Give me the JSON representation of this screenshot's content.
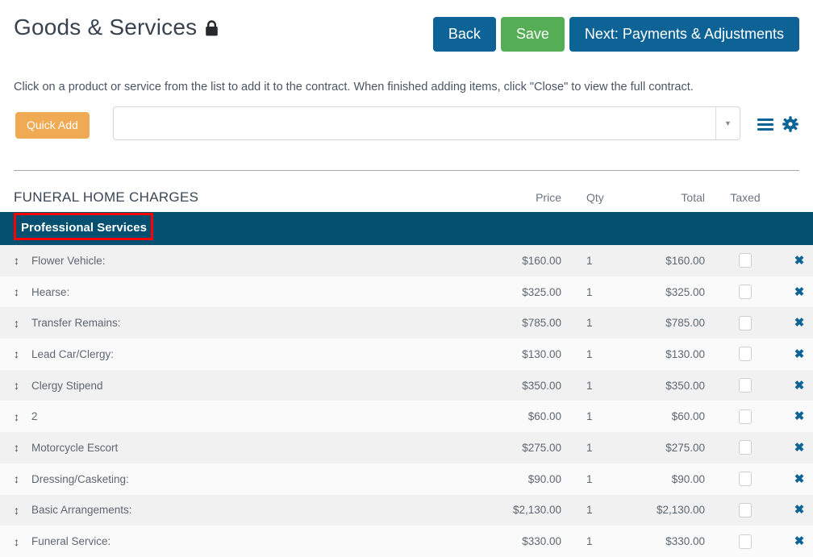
{
  "header": {
    "title": "Goods & Services",
    "lock_icon": "lock-icon",
    "buttons": {
      "back": "Back",
      "save": "Save",
      "next": "Next: Payments & Adjustments"
    }
  },
  "instructions": "Click on a product or service from the list to add it to the contract. When finished adding items, click \"Close\" to view the full contract.",
  "toolbar": {
    "quick_add_label": "Quick Add",
    "search_value": "",
    "search_placeholder": "",
    "caret_icon": "chevron-down-icon",
    "list_icon": "list-icon",
    "gear_icon": "gear-icon"
  },
  "table": {
    "group_title": "FUNERAL HOME CHARGES",
    "columns": {
      "price": "Price",
      "qty": "Qty",
      "total": "Total",
      "taxed": "Taxed"
    },
    "section": {
      "label": "Professional Services",
      "highlighted": true
    },
    "rows": [
      {
        "name": "Flower Vehicle:",
        "price": "$160.00",
        "qty": "1",
        "total": "$160.00",
        "taxed": false,
        "delete_icon": "close-icon"
      },
      {
        "name": "Hearse:",
        "price": "$325.00",
        "qty": "1",
        "total": "$325.00",
        "taxed": false,
        "delete_icon": "close-icon"
      },
      {
        "name": "Transfer Remains:",
        "price": "$785.00",
        "qty": "1",
        "total": "$785.00",
        "taxed": false,
        "delete_icon": "close-icon"
      },
      {
        "name": "Lead Car/Clergy:",
        "price": "$130.00",
        "qty": "1",
        "total": "$130.00",
        "taxed": false,
        "delete_icon": "close-icon"
      },
      {
        "name": "Clergy Stipend",
        "price": "$350.00",
        "qty": "1",
        "total": "$350.00",
        "taxed": false,
        "delete_icon": "close-icon"
      },
      {
        "name": "2",
        "price": "$60.00",
        "qty": "1",
        "total": "$60.00",
        "taxed": false,
        "delete_icon": "close-icon"
      },
      {
        "name": "Motorcycle Escort",
        "price": "$275.00",
        "qty": "1",
        "total": "$275.00",
        "taxed": false,
        "delete_icon": "close-icon"
      },
      {
        "name": "Dressing/Casketing:",
        "price": "$90.00",
        "qty": "1",
        "total": "$90.00",
        "taxed": false,
        "delete_icon": "close-icon"
      },
      {
        "name": "Basic Arrangements:",
        "price": "$2,130.00",
        "qty": "1",
        "total": "$2,130.00",
        "taxed": false,
        "delete_icon": "close-icon"
      },
      {
        "name": "Funeral Service:",
        "price": "$330.00",
        "qty": "1",
        "total": "$330.00",
        "taxed": false,
        "delete_icon": "close-icon"
      }
    ],
    "drag_handle_icon": "drag-vertical-icon",
    "drag_handle_glyph": "↕"
  },
  "colors": {
    "accent_blue": "#0d6396",
    "save_green": "#55ae55",
    "quick_add_orange": "#efaa53",
    "section_teal": "#055070",
    "annotation_red": "#fb0000",
    "row_alt": "#f1f1f1",
    "row_base": "#fafafa"
  }
}
